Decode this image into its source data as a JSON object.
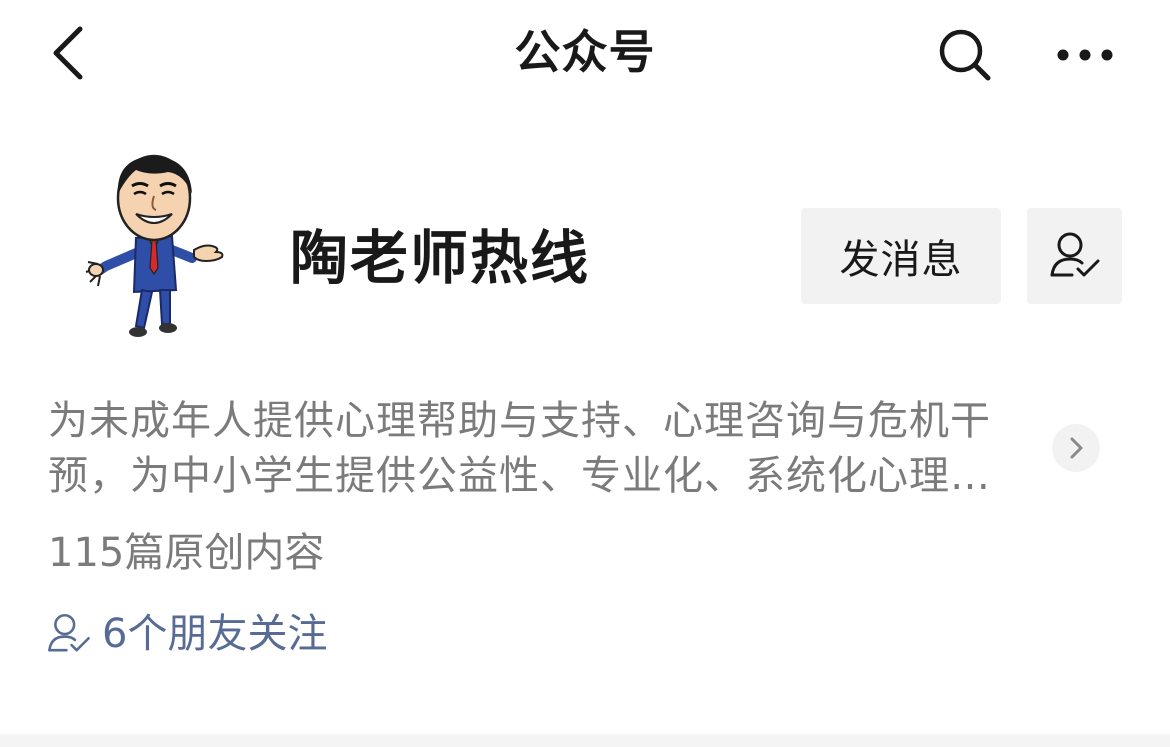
{
  "nav": {
    "title": "公众号",
    "back_icon": "chevron-left-icon",
    "search_icon": "search-icon",
    "more_icon": "more-dots-icon"
  },
  "profile": {
    "avatar": "cartoon-teacher-avatar",
    "name": "陶老师热线",
    "message_button": "发消息",
    "follow_icon": "user-check-icon"
  },
  "description": {
    "text": "为未成年人提供心理帮助与支持、心理咨询与危机干预，为中小学生提供公益性、专业化、系统化心理…",
    "expand_icon": "chevron-right-icon"
  },
  "meta": {
    "article_count": "115篇原创内容",
    "friends_text": "6个朋友关注",
    "friends_icon": "user-check-icon"
  },
  "colors": {
    "text_primary": "#191919",
    "text_secondary": "#7b7b7b",
    "link": "#576b95",
    "button_bg": "#f2f2f2"
  }
}
